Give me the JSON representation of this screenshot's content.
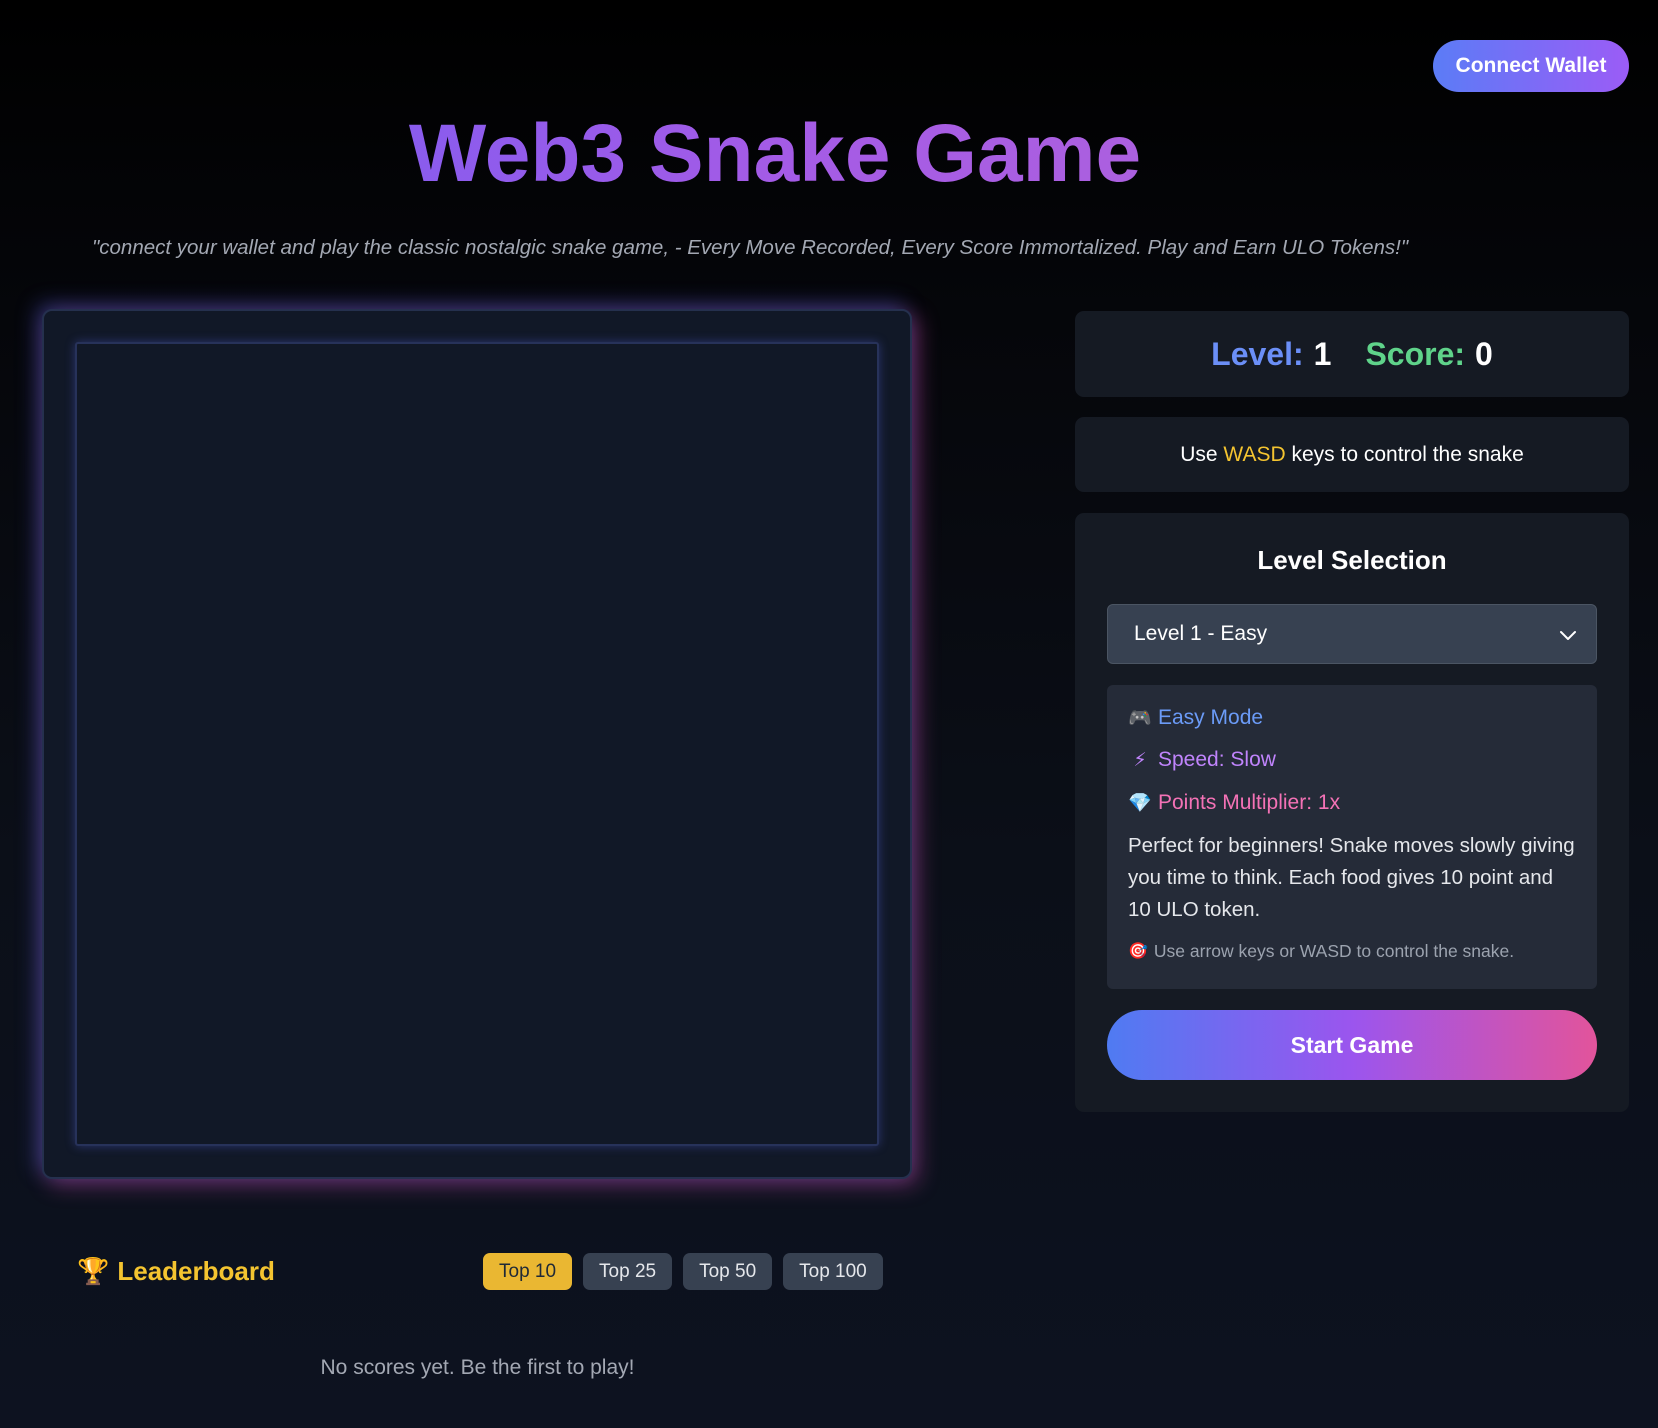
{
  "header": {
    "connect_wallet_label": "Connect Wallet",
    "title": "Web3 Snake Game",
    "tagline": "\"connect your wallet and play the classic nostalgic snake game, - Every Move Recorded, Every Score Immortalized. Play and Earn ULO Tokens!\""
  },
  "stats": {
    "level_label": "Level:",
    "level_value": "1",
    "score_label": "Score:",
    "score_value": "0"
  },
  "hint": {
    "prefix": "Use ",
    "key": "WASD",
    "suffix": " keys to control the snake"
  },
  "level_selection": {
    "heading": "Level Selection",
    "selected": "Level 1 - Easy",
    "mode_icon": "🎮",
    "mode": "Easy Mode",
    "speed_icon": "⚡",
    "speed": "Speed: Slow",
    "multiplier_icon": "💎",
    "multiplier": "Points Multiplier: 1x",
    "description": "Perfect for beginners! Snake moves slowly giving you time to think. Each food gives 10 point and 10 ULO token.",
    "controls_icon": "🎯",
    "controls_note": "Use arrow keys or WASD to control the snake.",
    "start_label": "Start Game"
  },
  "leaderboard": {
    "icon": "🏆",
    "title": "Leaderboard",
    "tabs": [
      "Top 10",
      "Top 25",
      "Top 50",
      "Top 100"
    ],
    "active_tab": "Top 10",
    "empty_message": "No scores yet. Be the first to play!"
  },
  "colors": {
    "accent_blue": "#5b7cf6",
    "accent_purple": "#9b5cf6",
    "accent_pink": "#e2549b",
    "gold": "#f4c430",
    "score_green": "#5fd38a"
  }
}
